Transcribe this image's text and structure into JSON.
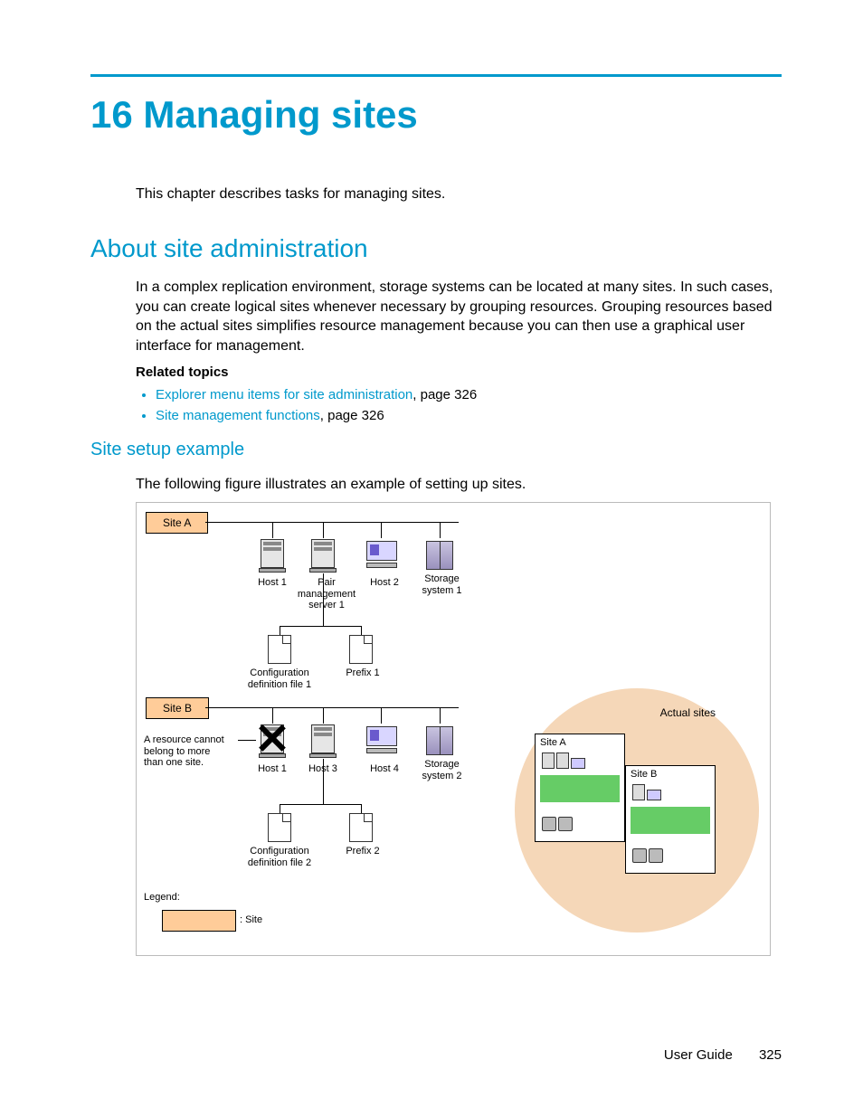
{
  "chapter": {
    "number": "16",
    "title": "Managing sites",
    "full": "16 Managing sites"
  },
  "intro": "This chapter describes tasks for managing sites.",
  "section1": {
    "heading": "About site administration",
    "body": "In a complex replication environment, storage systems can be located at many sites. In such cases, you can create logical sites whenever necessary by grouping resources. Grouping resources based on the actual sites simplifies resource management because you can then use a graphical user interface for management.",
    "relatedLabel": "Related topics",
    "links": [
      {
        "text": "Explorer menu items for site administration",
        "page": ", page 326"
      },
      {
        "text": "Site management functions",
        "page": ", page 326"
      }
    ]
  },
  "section2": {
    "heading": "Site setup example",
    "body": "The following figure illustrates an example of setting up sites."
  },
  "diagram": {
    "siteA": "Site A",
    "siteB": "Site B",
    "host1": "Host 1",
    "pairMgmt": "Pair\nmanagement\nserver 1",
    "host2": "Host 2",
    "storage1": "Storage\nsystem 1",
    "cfg1": "Configuration\ndefinition file 1",
    "prefix1": "Prefix 1",
    "note": "A resource cannot\nbelong to more\nthan one site.",
    "host3": "Host 3",
    "host4": "Host 4",
    "storage2": "Storage\nsystem 2",
    "cfg2": "Configuration\ndefinition file 2",
    "prefix2": "Prefix 2",
    "legend": "Legend:",
    "legendSite": ": Site",
    "actualSites": "Actual sites",
    "cardA": "Site A",
    "cardB": "Site B"
  },
  "footer": {
    "guide": "User Guide",
    "page": "325"
  }
}
